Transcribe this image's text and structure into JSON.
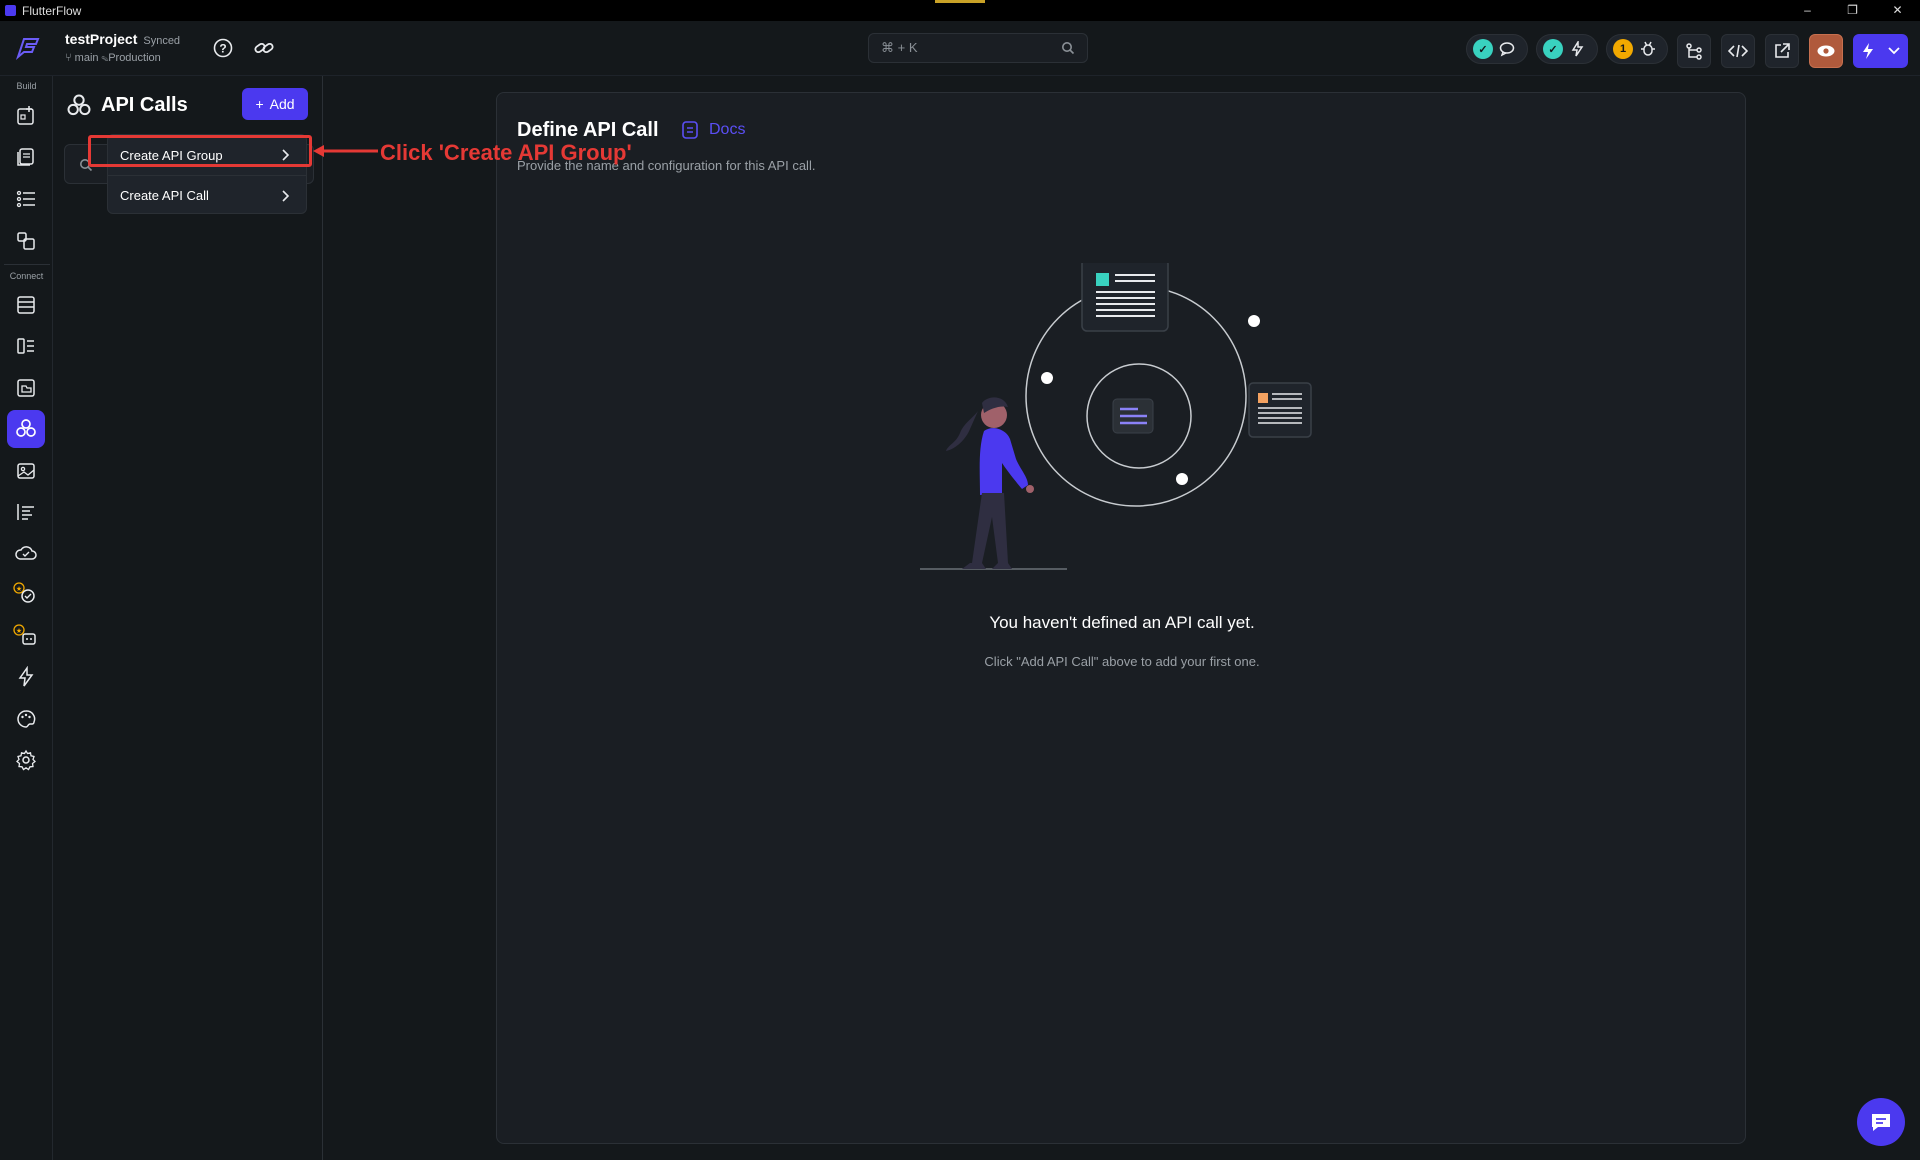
{
  "window": {
    "title": "FlutterFlow",
    "controls": [
      "–",
      "❐",
      "✕"
    ]
  },
  "header": {
    "project_name": "testProject",
    "sync_status": "Synced",
    "branch": "main",
    "environment": "Production",
    "search_placeholder": "⌘ + K",
    "notification_count": "1"
  },
  "rail": {
    "build_label": "Build",
    "connect_label": "Connect",
    "active_item": "api-calls"
  },
  "panel": {
    "title": "API Calls",
    "add_label": "Add",
    "menu": [
      {
        "label": "Create API Group"
      },
      {
        "label": "Create API Call"
      }
    ]
  },
  "annotation": {
    "text": "Click 'Create API Group'"
  },
  "main": {
    "title": "Define API Call",
    "docs_label": "Docs",
    "subtitle": "Provide the name and configuration for this API call.",
    "empty_title": "You haven't defined an API call yet.",
    "empty_subtitle": "Click \"Add API Call\" above to add your first one."
  },
  "colors": {
    "accent": "#4B39EF",
    "annotation": "#E53935",
    "teal": "#39D2C0",
    "orange": "#F4A261"
  }
}
